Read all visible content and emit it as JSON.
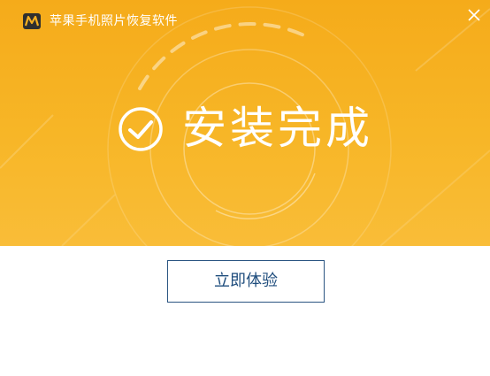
{
  "window": {
    "title": "苹果手机照片恢复软件",
    "close_icon": "close-icon"
  },
  "banner": {
    "status_text": "安装完成",
    "status_icon": "check-circle-icon",
    "background_color": "#f6b020"
  },
  "actions": {
    "primary_label": "立即体验"
  },
  "colors": {
    "accent": "#f6b020",
    "button_border": "#2b5582",
    "button_text": "#1f4d7d"
  }
}
